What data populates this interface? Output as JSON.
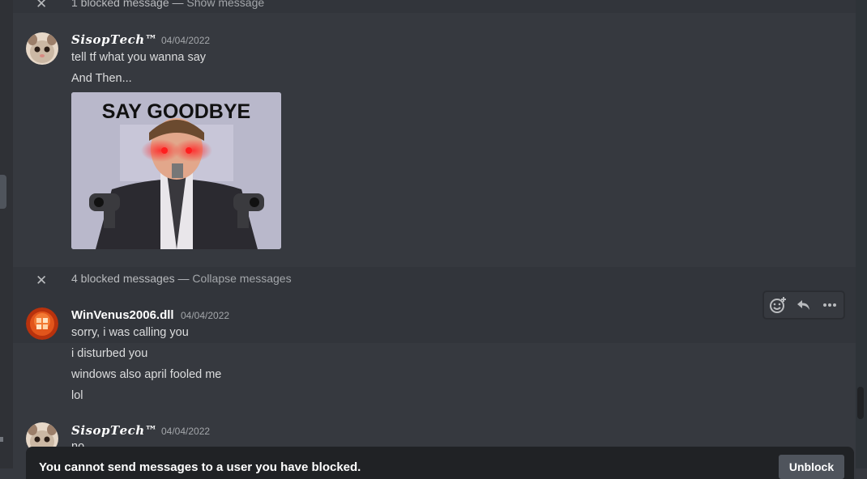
{
  "blocked_top": {
    "count_text": "1 blocked message",
    "sep": " — ",
    "action": "Show message"
  },
  "group1": {
    "username": "𝑺𝒊𝒔𝒐𝒑𝑻𝒆𝒄𝒉™",
    "timestamp": "04/04/2022",
    "messages": [
      "tell tf what you wanna say",
      "And Then..."
    ],
    "image_caption": "SAY GOODBYE"
  },
  "blocked_mid": {
    "count_text": "4 blocked messages",
    "sep": " — ",
    "action": "Collapse messages"
  },
  "group2": {
    "username": "WinVenus2006.dll",
    "timestamp": "04/04/2022",
    "messages": [
      "sorry, i was calling you",
      "i disturbed you",
      "windows also april fooled me",
      "lol"
    ]
  },
  "group3": {
    "username": "𝑺𝒊𝒔𝒐𝒑𝑻𝒆𝒄𝒉™",
    "timestamp": "04/04/2022",
    "messages": [
      "no"
    ]
  },
  "toolbar": {
    "icons": [
      "add-reaction-icon",
      "reply-icon",
      "more-icon"
    ]
  },
  "footer": {
    "notice": "You cannot send messages to a user you have blocked.",
    "unblock_label": "Unblock"
  },
  "colors": {
    "background": "#36393f",
    "blocked_bar": "#32353b",
    "footer": "#202225",
    "button": "#4f545c"
  }
}
